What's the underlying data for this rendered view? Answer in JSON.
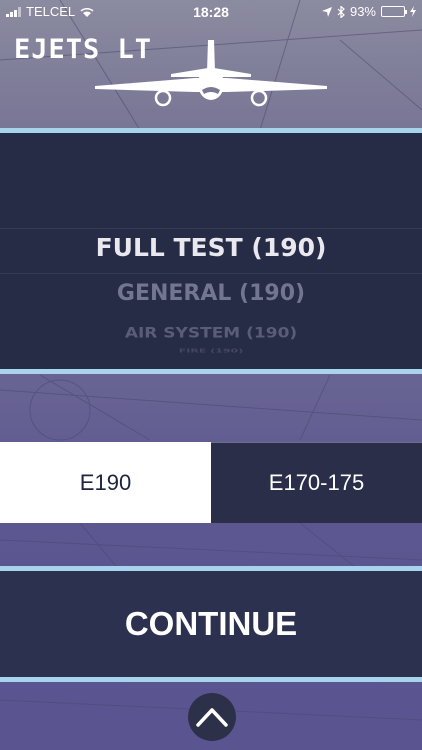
{
  "status_bar": {
    "carrier": "TELCEL",
    "time": "18:28",
    "battery": "93%",
    "battery_level": 0.93,
    "icons": [
      "signal-icon",
      "wifi-icon",
      "location-icon",
      "bluetooth-icon",
      "battery-icon",
      "charging-icon"
    ]
  },
  "header": {
    "title": "EJETS  LT",
    "logo_icon": "airplane-icon"
  },
  "picker": {
    "options": [
      "FULL TEST (190)",
      "GENERAL (190)",
      "AIR SYSTEM (190)",
      "FIRE (190)"
    ],
    "selected": "FULL TEST (190)"
  },
  "aircraft_toggle": {
    "left": "E190",
    "right": "E170-175",
    "selected": "E190"
  },
  "continue_label": "CONTINUE",
  "bottom_button_icon": "chevron-up-icon",
  "colors": {
    "accent_divider": "#a9d3ec",
    "panel_dark": "#262b46",
    "continue_bg": "#2d3150",
    "battery_green": "#4cd964"
  }
}
